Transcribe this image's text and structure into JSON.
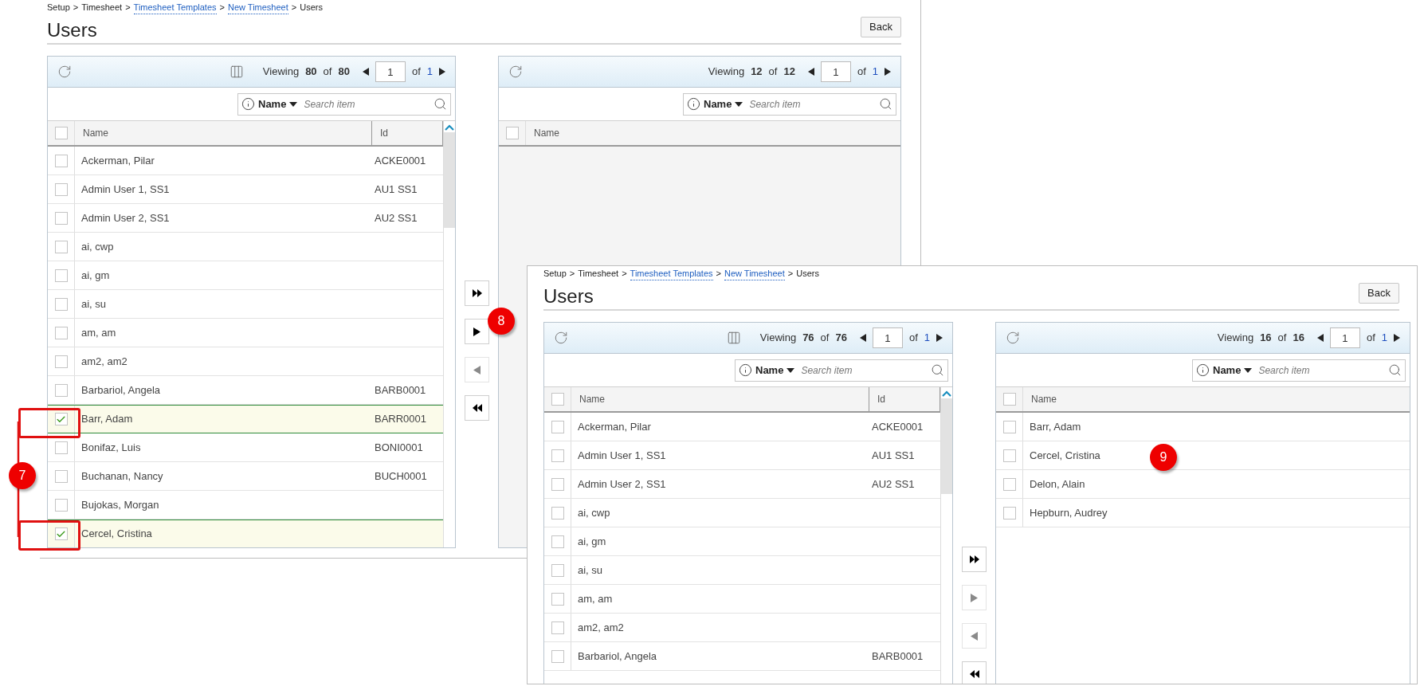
{
  "screens": [
    {
      "breadcrumb": {
        "separator": ">",
        "items": [
          {
            "text": "Setup",
            "link": false
          },
          {
            "text": "Timesheet",
            "link": false
          },
          {
            "text": "Timesheet Templates",
            "link": true
          },
          {
            "text": "New Timesheet",
            "link": true
          },
          {
            "text": "Users",
            "link": false
          }
        ]
      },
      "title": "Users",
      "back_button": "Back",
      "available": {
        "viewing_label": "Viewing",
        "viewing_count": "80",
        "of_label": "of",
        "viewing_total": "80",
        "page": "1",
        "pages_label": "of",
        "pages": "1",
        "search": {
          "field": "Name",
          "placeholder": "Search item"
        },
        "all_checked": false,
        "columns": [
          "Name",
          "Id"
        ],
        "rows": [
          {
            "name": "Ackerman, Pilar",
            "id": "ACKE0001",
            "checked": false
          },
          {
            "name": "Admin User 1, SS1",
            "id": "AU1 SS1",
            "checked": false
          },
          {
            "name": "Admin User 2, SS1",
            "id": "AU2 SS1",
            "checked": false
          },
          {
            "name": "ai, cwp",
            "checked": false
          },
          {
            "name": "ai, gm",
            "checked": false
          },
          {
            "name": "ai, su",
            "checked": false
          },
          {
            "name": "am, am",
            "checked": false
          },
          {
            "name": "am2, am2",
            "checked": false
          },
          {
            "name": "Barbariol, Angela",
            "id": "BARB0001",
            "checked": false
          },
          {
            "name": "Barr, Adam",
            "id": "BARR0001",
            "checked": true
          },
          {
            "name": "Bonifaz, Luis",
            "id": "BONI0001",
            "checked": false
          },
          {
            "name": "Buchanan, Nancy",
            "id": "BUCH0001",
            "checked": false
          },
          {
            "name": "Bujokas, Morgan",
            "checked": false
          },
          {
            "name": "Cercel, Cristina",
            "checked": true
          }
        ]
      },
      "transfer_buttons": [
        {
          "kind": "all_right",
          "disabled": false
        },
        {
          "kind": "right",
          "disabled": false
        },
        {
          "kind": "left",
          "disabled": true
        },
        {
          "kind": "all_left",
          "disabled": false
        }
      ],
      "chosen": {
        "viewing_label": "Viewing",
        "viewing_count": "12",
        "of_label": "of",
        "viewing_total": "12",
        "page": "1",
        "pages_label": "of",
        "pages": "1",
        "search": {
          "field": "Name",
          "placeholder": "Search item"
        },
        "all_checked": false,
        "columns": [
          "Name"
        ]
      }
    },
    {
      "breadcrumb": {
        "separator": ">",
        "items": [
          {
            "text": "Setup",
            "link": false
          },
          {
            "text": "Timesheet",
            "link": false
          },
          {
            "text": "Timesheet Templates",
            "link": true
          },
          {
            "text": "New Timesheet",
            "link": true
          },
          {
            "text": "Users",
            "link": false
          }
        ]
      },
      "title": "Users",
      "back_button": "Back",
      "available": {
        "viewing_label": "Viewing",
        "viewing_count": "76",
        "of_label": "of",
        "viewing_total": "76",
        "page": "1",
        "pages_label": "of",
        "pages": "1",
        "search": {
          "field": "Name",
          "placeholder": "Search item"
        },
        "all_checked": false,
        "columns": [
          "Name",
          "Id"
        ],
        "rows": [
          {
            "name": "Ackerman, Pilar",
            "id": "ACKE0001",
            "checked": false
          },
          {
            "name": "Admin User 1, SS1",
            "id": "AU1 SS1",
            "checked": false
          },
          {
            "name": "Admin User 2, SS1",
            "id": "AU2 SS1",
            "checked": false
          },
          {
            "name": "ai, cwp",
            "checked": false
          },
          {
            "name": "ai, gm",
            "checked": false
          },
          {
            "name": "ai, su",
            "checked": false
          },
          {
            "name": "am, am",
            "checked": false
          },
          {
            "name": "am2, am2",
            "checked": false
          },
          {
            "name": "Barbariol, Angela",
            "id": "BARB0001",
            "checked": false
          }
        ]
      },
      "transfer_buttons": [
        {
          "kind": "all_right",
          "disabled": false
        },
        {
          "kind": "right",
          "disabled": true
        },
        {
          "kind": "left",
          "disabled": true
        },
        {
          "kind": "all_left",
          "disabled": false
        }
      ],
      "chosen": {
        "viewing_label": "Viewing",
        "viewing_count": "16",
        "of_label": "of",
        "viewing_total": "16",
        "page": "1",
        "pages_label": "of",
        "pages": "1",
        "search": {
          "field": "Name",
          "placeholder": "Search item"
        },
        "all_checked": false,
        "columns": [
          "Name"
        ],
        "rows": [
          {
            "name": "Barr, Adam",
            "checked": false
          },
          {
            "name": "Cercel, Cristina",
            "checked": false
          },
          {
            "name": "Delon, Alain",
            "checked": false
          },
          {
            "name": "Hepburn, Audrey",
            "checked": false
          }
        ]
      }
    }
  ],
  "annotations": [
    {
      "label": "7"
    },
    {
      "label": "8"
    },
    {
      "label": "9"
    }
  ]
}
